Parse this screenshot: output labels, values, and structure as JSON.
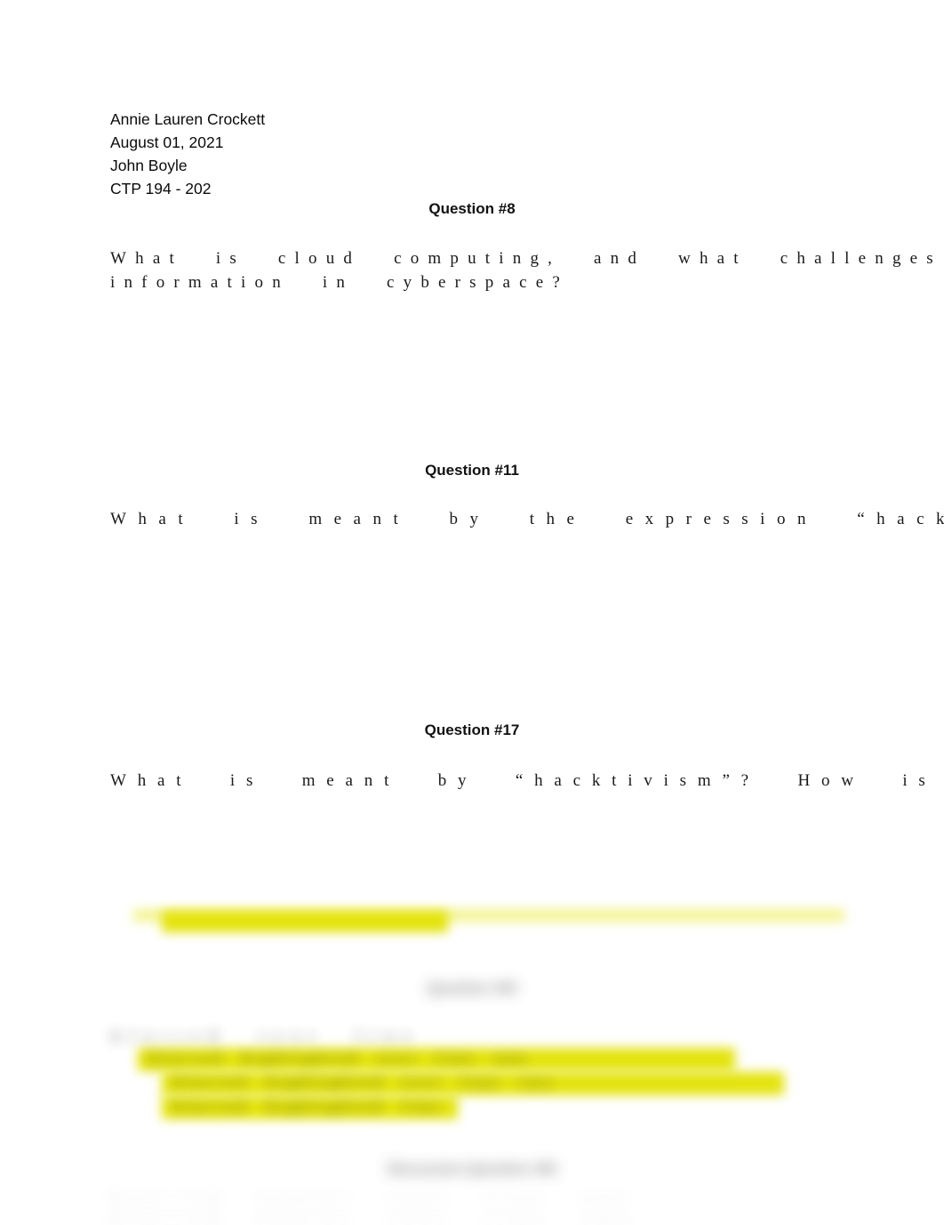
{
  "document": {
    "header": {
      "author": "Annie Lauren Crockett",
      "date": "August 01, 2021",
      "instructor": "John Boyle",
      "course": "CTP 194 - 202"
    },
    "sections": [
      {
        "heading": "Question #8",
        "body_line_1": "What is cloud computing, and what challenges",
        "body_line_2": "information in cyberspace?"
      },
      {
        "heading": "Question #11",
        "body_line_1": "What is meant by the expression “hacker code",
        "body_line_2": ""
      },
      {
        "heading": "Question #17",
        "body_line_1": "What is meant by “hacktivism”? How is it dis",
        "body_line_2": ""
      }
    ],
    "obscured": {
      "note": "lower portion of page is blurred and illegible",
      "heading_1": "Question #00",
      "heading_2": "Discussion Question #00",
      "line_1": "blurred text line",
      "highlight_line_1": "blurred highlighted text line one",
      "highlight_line_2": "blurred highlighted text line two",
      "highlight_line_3": "blurred highlighted line",
      "footer_line_1": "blurred footer text line one",
      "footer_line_2": "blurred footer text line two"
    },
    "colors": {
      "page_background": "#ffffff",
      "text": "#000000",
      "highlight_yellow": "#e2e200"
    }
  }
}
